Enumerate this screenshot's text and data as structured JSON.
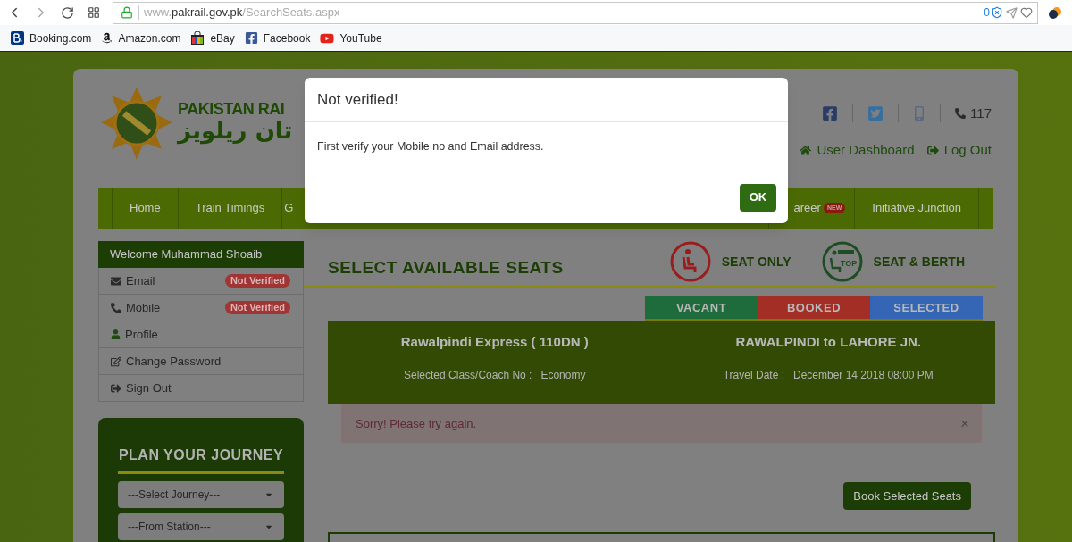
{
  "browser": {
    "url_prefix": "www.",
    "url_host": "pakrail.gov.pk",
    "url_path": "/SearchSeats.aspx",
    "blocked_count": "0",
    "bookmarks": [
      {
        "label": "Booking.com",
        "kind": "booking"
      },
      {
        "label": "Amazon.com",
        "kind": "amazon"
      },
      {
        "label": "eBay",
        "kind": "bag"
      },
      {
        "label": "Facebook",
        "kind": "facebook"
      },
      {
        "label": "YouTube",
        "kind": "youtube"
      }
    ]
  },
  "header": {
    "logo_text": "PAKISTAN RAI",
    "logo_urdu": "تان ریلویز",
    "phone": "117",
    "links": [
      {
        "label": "User Dashboard",
        "kind": "home"
      },
      {
        "label": "Log Out",
        "kind": "logout"
      }
    ]
  },
  "nav": [
    {
      "label": "Home",
      "kind": "fixed"
    },
    {
      "label": "Train Timings",
      "kind": "fixed"
    },
    {
      "label": "G",
      "kind": "covered"
    },
    {
      "label": "areer",
      "kind": "fixed",
      "badge": "NEW"
    },
    {
      "label": "Initiative Junction",
      "kind": "fixed"
    }
  ],
  "sidebar": {
    "welcome": "Welcome Muhammad Shoaib",
    "items": [
      {
        "label": "Email",
        "kind": "email",
        "badge": "Not Verified"
      },
      {
        "label": "Mobile",
        "kind": "phone",
        "badge": "Not Verified"
      },
      {
        "label": "Profile",
        "kind": "user"
      },
      {
        "label": "Change Password",
        "kind": "edit"
      },
      {
        "label": "Sign Out",
        "kind": "signout"
      }
    ]
  },
  "journey": {
    "title": "PLAN YOUR JOURNEY",
    "selects": [
      {
        "value": "---Select Journey---"
      },
      {
        "value": "---From Station---"
      }
    ]
  },
  "main": {
    "title": "SELECT AVAILABLE SEATS",
    "seat_types": [
      {
        "label": "SEAT ONLY",
        "kind": "seat"
      },
      {
        "label": "SEAT & BERTH",
        "kind": "berth",
        "icon_text": "TOP"
      }
    ],
    "legend": [
      {
        "label": "VACANT",
        "color": "#1e6b3c"
      },
      {
        "label": "BOOKED",
        "color": "#a32e26"
      },
      {
        "label": "SELECTED",
        "color": "#3565b5"
      }
    ],
    "train": {
      "name": "Rawalpindi Express ( 110DN )",
      "class_label": "Selected Class/Coach No :",
      "class_value": "Economy",
      "route": "RAWALPINDI to LAHORE JN.",
      "date_label": "Travel Date :",
      "date_value": "December 14 2018 08:00 PM"
    },
    "alert": {
      "text": "Sorry! Please try again.",
      "close": "×"
    },
    "book_button": "Book Selected Seats"
  },
  "modal": {
    "title": "Not verified!",
    "message": "First verify your Mobile no and Email address.",
    "ok": "OK"
  }
}
